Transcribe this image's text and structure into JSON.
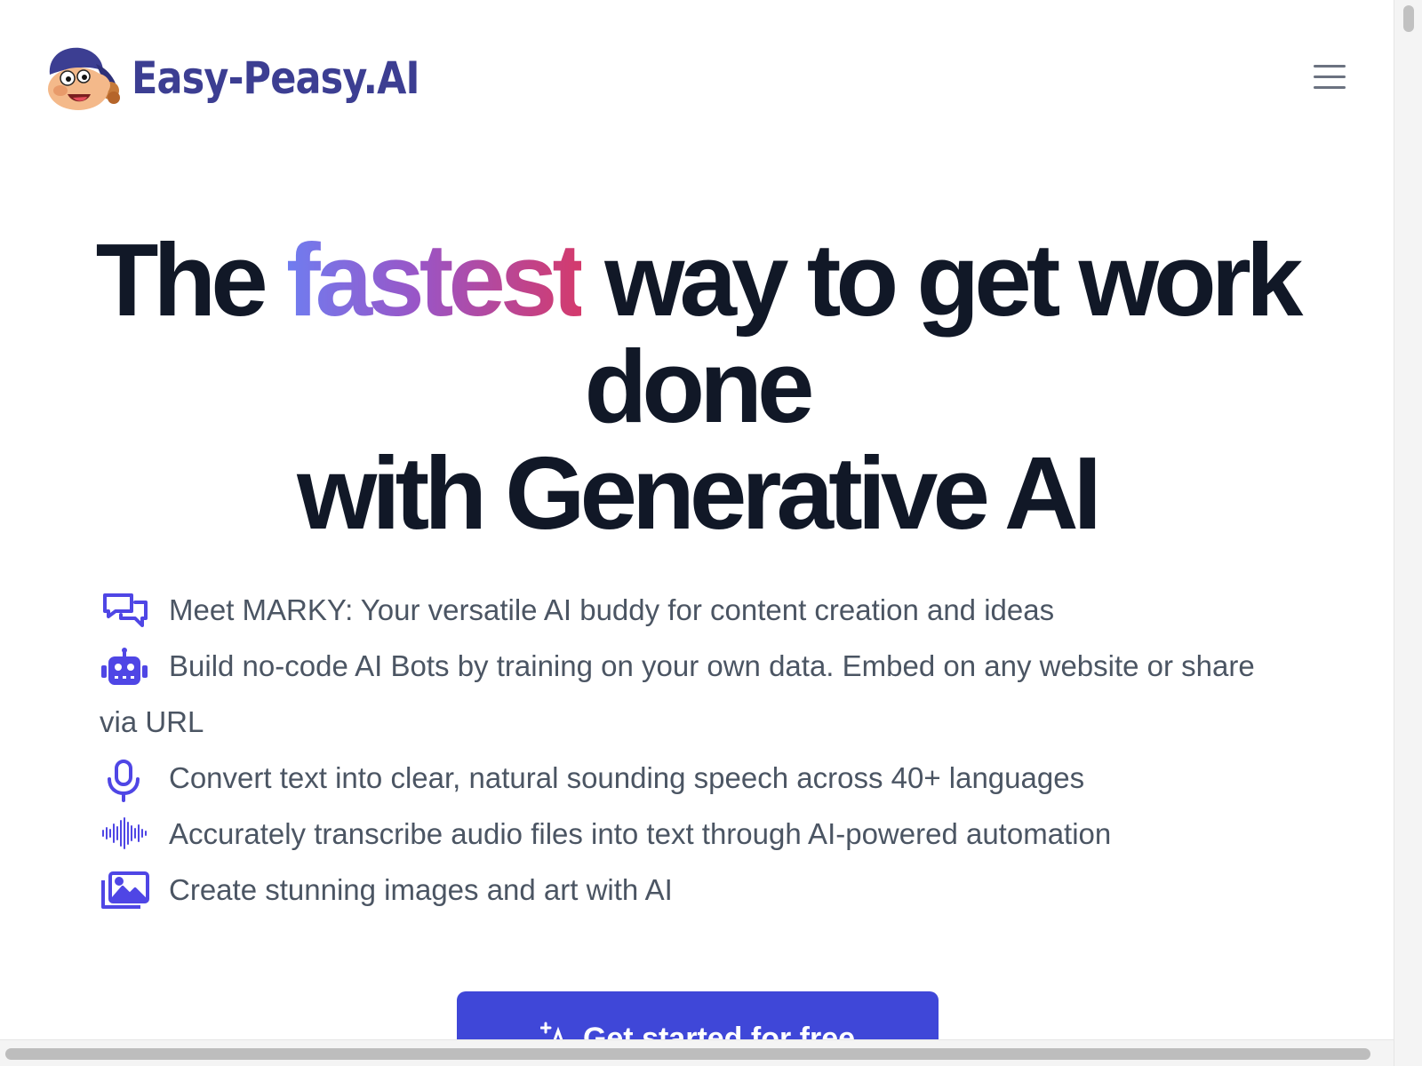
{
  "brand": {
    "name": "Easy-Peasy.AI",
    "logo_icon": "mascot-logo-icon",
    "color": "#3c3e92"
  },
  "header": {
    "menu_icon": "hamburger-menu-icon"
  },
  "hero": {
    "title_before": "The ",
    "title_highlight": "fastest",
    "title_after_line1": " way to get work done",
    "title_line2": "with Generative AI",
    "highlight_gradient": [
      "#6f7df0",
      "#9a55c6",
      "#d43a6c"
    ],
    "title_color": "#111827"
  },
  "features": [
    {
      "icon": "chat-bubbles-icon",
      "text": "Meet MARKY: Your versatile AI buddy for content creation and ideas"
    },
    {
      "icon": "robot-icon",
      "text": "Build no-code AI Bots by training on your own data. Embed on any website or share via URL"
    },
    {
      "icon": "microphone-icon",
      "text": "Convert text into clear, natural sounding speech across 40+ languages"
    },
    {
      "icon": "audio-waveform-icon",
      "text": "Accurately transcribe audio files into text through AI-powered automation"
    },
    {
      "icon": "image-gallery-icon",
      "text": "Create stunning images and art with AI"
    }
  ],
  "feature_icon_color": "#4f46e5",
  "cta": {
    "label": "Get started for free",
    "icon": "sparkle-text-icon",
    "color": "#3f47d8"
  }
}
